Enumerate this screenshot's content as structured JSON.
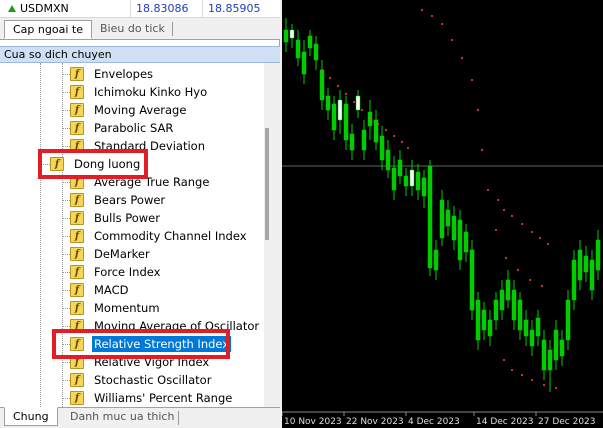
{
  "market_watch": {
    "symbol": "USDMXN",
    "bid": "18.83086",
    "ask": "18.85905",
    "tabs": [
      "Cap ngoai te",
      "Bieu do tick"
    ]
  },
  "navigator": {
    "title": "Cua so dich chuyen",
    "items": [
      {
        "label": "Envelopes",
        "level": 2
      },
      {
        "label": "Ichimoku Kinko Hyo",
        "level": 2
      },
      {
        "label": "Moving Average",
        "level": 2
      },
      {
        "label": "Parabolic SAR",
        "level": 2
      },
      {
        "label": "Standard Deviation",
        "level": 2
      },
      {
        "label": "Dong luong",
        "level": 1
      },
      {
        "label": "Average True Range",
        "level": 2
      },
      {
        "label": "Bears Power",
        "level": 2
      },
      {
        "label": "Bulls Power",
        "level": 2
      },
      {
        "label": "Commodity Channel Index",
        "level": 2
      },
      {
        "label": "DeMarker",
        "level": 2
      },
      {
        "label": "Force Index",
        "level": 2
      },
      {
        "label": "MACD",
        "level": 2
      },
      {
        "label": "Momentum",
        "level": 2
      },
      {
        "label": "Moving Average of Oscillator",
        "level": 2
      },
      {
        "label": "Relative Strength Index",
        "level": 2,
        "selected": true
      },
      {
        "label": "Relative Vigor Index",
        "level": 2
      },
      {
        "label": "Stochastic Oscillator",
        "level": 2
      },
      {
        "label": "Williams' Percent Range",
        "level": 2
      }
    ],
    "bottom_tabs": [
      "Chung",
      "Danh muc ua thich"
    ]
  },
  "chart": {
    "x_labels": [
      "10 Nov 2023",
      "22 Nov 2023",
      "4 Dec 2023",
      "14 Dec 2023",
      "27 Dec 2023"
    ],
    "colors": {
      "background": "#000000",
      "bull": "#ffffff",
      "bear": "#00cc00",
      "sar": "#ff4444",
      "price_line": "#5a6b5a"
    }
  }
}
